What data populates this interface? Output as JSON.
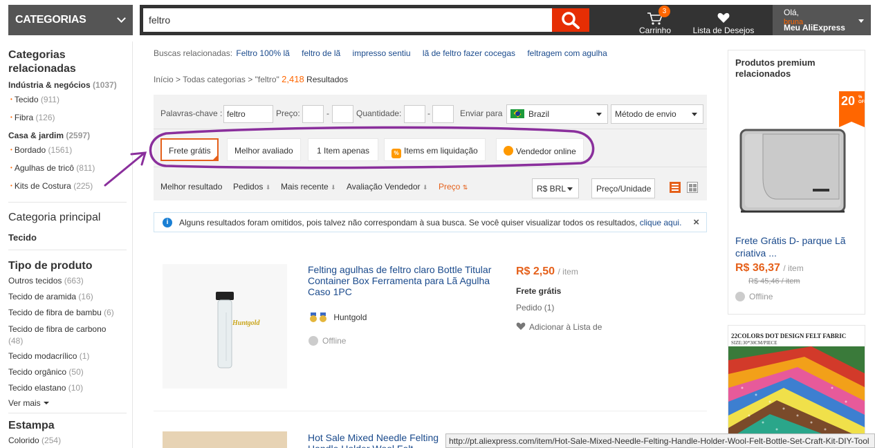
{
  "header": {
    "categories_label": "CATEGORIAS",
    "search_value": "feltro",
    "cart_label": "Carrinho",
    "cart_count": "3",
    "wishlist_label": "Lista de Desejos",
    "greeting": "Olá,",
    "user_name": "bruna",
    "account_label": "Meu AliExpress"
  },
  "sidebar": {
    "related_title_1": "Categorias",
    "related_title_2": "relacionadas",
    "groups": [
      {
        "label": "Indústria & negócios",
        "count": "(1037)"
      },
      {
        "label": "Tecido",
        "count": "(911)"
      },
      {
        "label": "Fibra",
        "count": "(126)"
      },
      {
        "label": "Casa & jardim",
        "count": "(2597)"
      },
      {
        "label": "Bordado",
        "count": "(1561)"
      },
      {
        "label": "Agulhas de tricô",
        "count": "(811)"
      },
      {
        "label": "Kits de Costura",
        "count": "(225)"
      }
    ],
    "main_cat_title": "Categoria principal",
    "main_cat_value": "Tecido",
    "product_type_title": "Tipo de produto",
    "types": [
      {
        "label": "Outros tecidos",
        "count": "(663)"
      },
      {
        "label": "Tecido de aramida",
        "count": "(16)"
      },
      {
        "label": "Tecido de fibra de bambu",
        "count": "(6)"
      },
      {
        "label": "Tecido de fibra de carbono",
        "count": "(48)"
      },
      {
        "label": "Tecido modacrílico",
        "count": "(1)"
      },
      {
        "label": "Tecido orgânico",
        "count": "(50)"
      },
      {
        "label": "Tecido elastano",
        "count": "(10)"
      }
    ],
    "see_more": "Ver mais",
    "print_title": "Estampa",
    "print_item": {
      "label": "Colorido",
      "count": "(254)"
    }
  },
  "related": {
    "label": "Buscas relacionadas:",
    "links": [
      "Feltro 100% lã",
      "feltro de lã",
      "impresso sentiu",
      "lã de feltro fazer cocegas",
      "feltragem com agulha"
    ]
  },
  "breadcrumb": {
    "home": "Início",
    "sep": ">",
    "all": "Todas categorias",
    "query": "\"feltro\"",
    "count": "2,418",
    "results": "Resultados"
  },
  "filters": {
    "keyword_label": "Palavras-chave :",
    "keyword_value": "feltro",
    "price_label": "Preço:",
    "qty_label": "Quantidade:",
    "dash": "-",
    "ship_to_label": "Enviar para",
    "country": "Brazil",
    "ship_method": "Método de envio",
    "chips": [
      "Frete grátis",
      "Melhor avaliado",
      "1 Item apenas",
      "Items em liquidação",
      "Vendedor online"
    ],
    "sale_icon_text": "%",
    "sort": [
      "Melhor resultado",
      "Pedidos",
      "Mais recente",
      "Avaliação Vendedor",
      "Preço"
    ],
    "currency": "R$ BRL",
    "unit_price": "Preço/Unidade"
  },
  "info": {
    "text": "Alguns resultados foram omitidos, pois talvez não correspondam à sua busca. Se você quiser visualizar todos os resultados,",
    "link": "clique aqui.",
    "close": "×",
    "icon_text": "i"
  },
  "products": [
    {
      "title": "Felting agulhas de feltro claro Bottle Titular Container Box Ferramenta para Lã Agulha Caso 1PC",
      "price": "R$ 2,50",
      "per": "/ item",
      "shipping": "Frete grátis",
      "orders": "Pedido (1)",
      "wishlist": "Adicionar à Lista de",
      "seller": "Huntgold",
      "status": "Offline",
      "image_text": "Huntgold"
    },
    {
      "title": "Hot Sale Mixed Needle Felting Handle Holder Wool Felt Carrafa Kit Set Artesanato"
    }
  ],
  "premium": {
    "title": "Produtos premium relacionados",
    "discount": "20",
    "discount_suffix_1": "%",
    "discount_suffix_2": "OFF",
    "item_title": "Frete Grátis D- parque Lã criativa ...",
    "price": "R$ 36,37",
    "per": "/ item",
    "old_price": "R$ 45,46 / item",
    "status": "Offline",
    "banner_title": "22COLORS DOT DESIGN FELT FABRIC",
    "banner_sub": "SIZE:30*30CM/PIECE"
  },
  "status_bar": {
    "url": "http://pt.aliexpress.com/item/Hot-Sale-Mixed-Needle-Felting-Handle-Holder-Wool-Felt-Bottle-Set-Craft-Kit-DIY-Tool"
  },
  "colors": {
    "accent": "#e5601a",
    "search_button": "#e62e04",
    "link": "#1a4a8c",
    "annotation": "#8a2f9c"
  }
}
